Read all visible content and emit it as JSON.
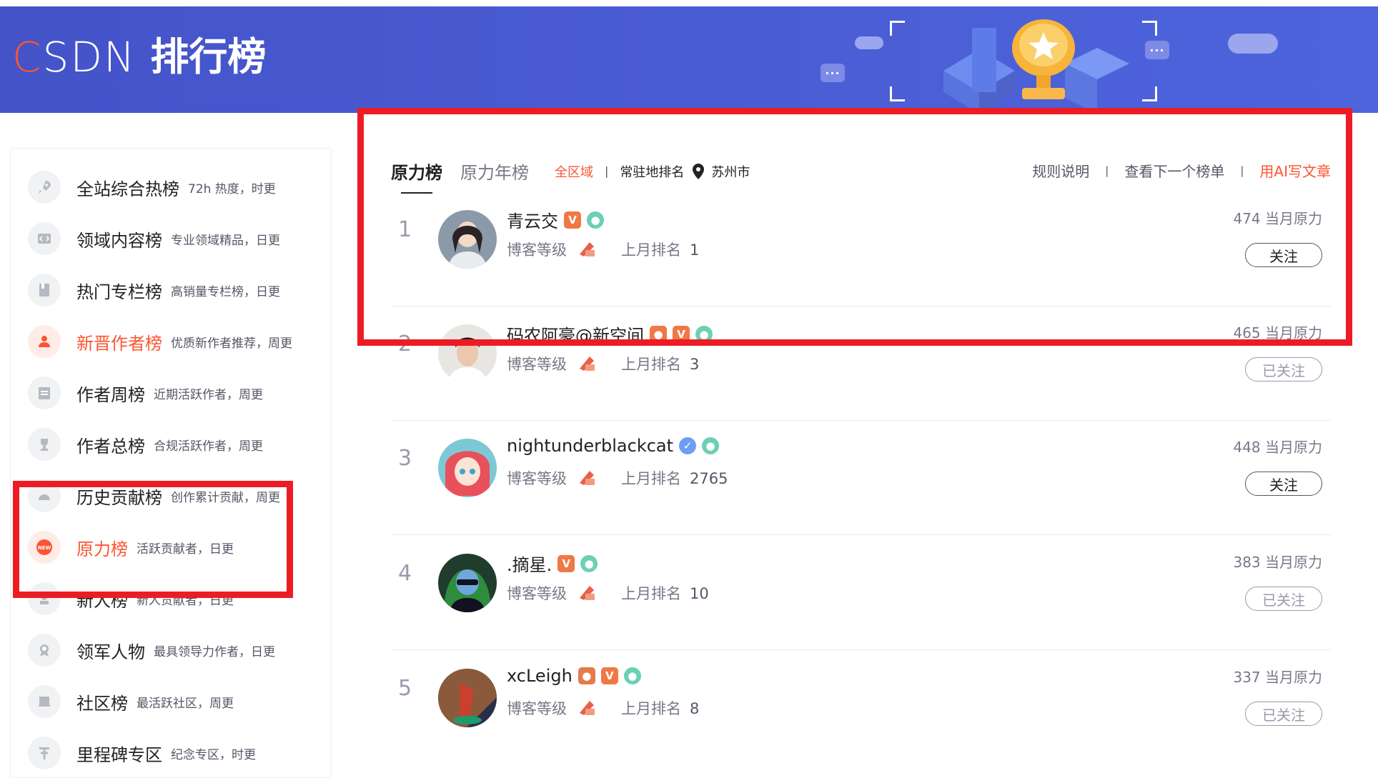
{
  "header": {
    "logo_text": "CSDN",
    "title": "排行榜",
    "brand_color": "#fc5531",
    "bg_color": "#4a5cd4"
  },
  "sidebar": {
    "items": [
      {
        "label": "全站综合热榜",
        "desc": "72h 热度，时更",
        "icon": "rocket-icon",
        "active": false
      },
      {
        "label": "领域内容榜",
        "desc": "专业领域精品，日更",
        "icon": "code-icon",
        "active": false
      },
      {
        "label": "热门专栏榜",
        "desc": "高销量专栏榜，日更",
        "icon": "book-icon",
        "active": false
      },
      {
        "label": "新晋作者榜",
        "desc": "优质新作者推荐，周更",
        "icon": "user-icon",
        "active": true
      },
      {
        "label": "作者周榜",
        "desc": "近期活跃作者，周更",
        "icon": "calendar-icon",
        "active": false
      },
      {
        "label": "作者总榜",
        "desc": "合规活跃作者，周更",
        "icon": "trophy-icon",
        "active": false
      },
      {
        "label": "历史贡献榜",
        "desc": "创作累计贡献，周更",
        "icon": "history-icon",
        "active": false
      },
      {
        "label": "原力榜",
        "desc": "活跃贡献者，日更",
        "icon": "new-badge-icon",
        "active": true
      },
      {
        "label": "新人榜",
        "desc": "新人贡献者，日更",
        "icon": "newbie-icon",
        "active": false
      },
      {
        "label": "领军人物",
        "desc": "最具领导力作者，日更",
        "icon": "medal-icon",
        "active": false
      },
      {
        "label": "社区榜",
        "desc": "最活跃社区，周更",
        "icon": "flag-icon",
        "active": false
      },
      {
        "label": "里程碑专区",
        "desc": "纪念专区，时更",
        "icon": "milestone-icon",
        "active": false
      }
    ]
  },
  "main": {
    "tabs": [
      {
        "label": "原力榜",
        "active": true
      },
      {
        "label": "原力年榜",
        "active": false
      }
    ],
    "filter_region": "全区域",
    "filter_resident": "常驻地排名",
    "location": "苏州市",
    "links": {
      "rules": "规则说明",
      "next": "查看下一个榜单",
      "ai": "用AI写文章"
    },
    "list": [
      {
        "rank": "1",
        "name": "青云交",
        "level_label": "博客等级",
        "last_rank_label": "上月排名",
        "last_rank": "1",
        "power": "474 当月原力",
        "follow": "关注",
        "followed": false
      },
      {
        "rank": "2",
        "name": "码农阿豪@新空间",
        "level_label": "博客等级",
        "last_rank_label": "上月排名",
        "last_rank": "3",
        "power": "465 当月原力",
        "follow": "已关注",
        "followed": true
      },
      {
        "rank": "3",
        "name": "nightunderblackcat",
        "level_label": "博客等级",
        "last_rank_label": "上月排名",
        "last_rank": "2765",
        "power": "448 当月原力",
        "follow": "关注",
        "followed": false
      },
      {
        "rank": "4",
        "name": ".摘星.",
        "level_label": "博客等级",
        "last_rank_label": "上月排名",
        "last_rank": "10",
        "power": "383 当月原力",
        "follow": "已关注",
        "followed": true
      },
      {
        "rank": "5",
        "name": "xcLeigh",
        "level_label": "博客等级",
        "last_rank_label": "上月排名",
        "last_rank": "8",
        "power": "337 当月原力",
        "follow": "已关注",
        "followed": true
      }
    ]
  }
}
